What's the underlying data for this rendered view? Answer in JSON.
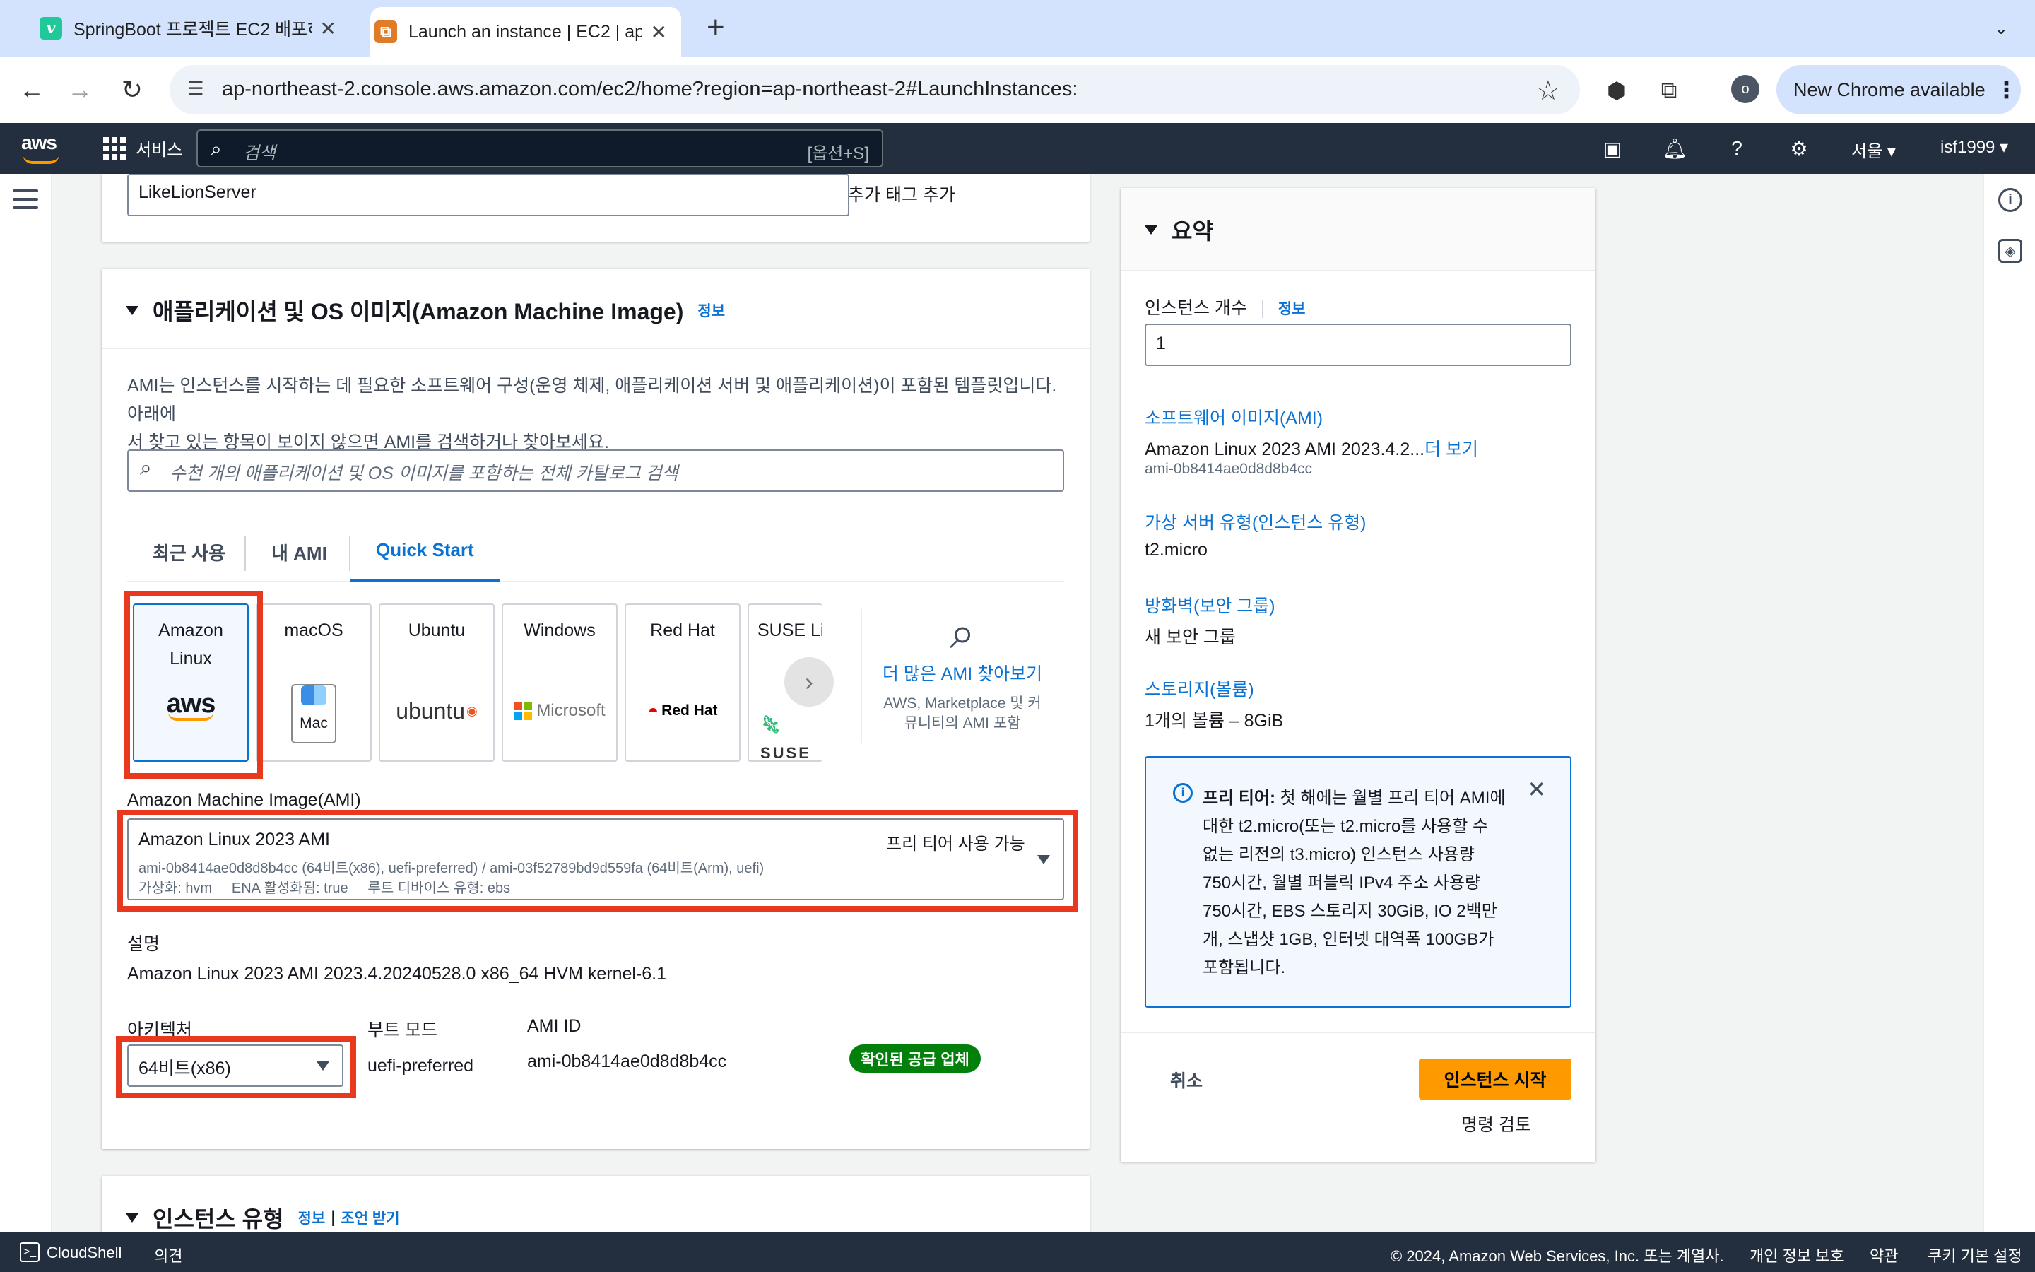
{
  "browser": {
    "tabs": [
      {
        "title": "SpringBoot 프로젝트 EC2 배포하기",
        "favicon": "v"
      },
      {
        "title": "Launch an instance | EC2 | ap-northeast-2",
        "favicon": "⧉"
      }
    ],
    "url": "ap-northeast-2.console.aws.amazon.com/ec2/home?region=ap-northeast-2#LaunchInstances:",
    "new_chrome_label": "New Chrome available",
    "profile_initial": "o"
  },
  "aws_nav": {
    "logo": "aws",
    "services_label": "서비스",
    "search_placeholder": "검색",
    "search_shortcut": "[옵션+S]",
    "region": "서울",
    "account": "isf1999"
  },
  "name_section": {
    "name_value": "LikeLionServer",
    "add_tag_label": "추가 태그 추가"
  },
  "ami_section": {
    "title": "애플리케이션 및 OS 이미지(Amazon Machine Image)",
    "info_label": "정보",
    "description": "AMI는 인스턴스를 시작하는 데 필요한 소프트웨어 구성(운영 체제, 애플리케이션 서버 및 애플리케이션)이 포함된 템플릿입니다. 아래에서 찾고 있는 항목이 보이지 않으면 AMI를 검색하거나 찾아보세요.",
    "description_line1": "AMI는 인스턴스를 시작하는 데 필요한 소프트웨어 구성(운영 체제, 애플리케이션 서버 및 애플리케이션)이 포함된 템플릿입니다. 아래에",
    "description_line2": "서 찾고 있는 항목이 보이지 않으면 AMI를 검색하거나 찾아보세요.",
    "search_placeholder": "수천 개의 애플리케이션 및 OS 이미지를 포함하는 전체 카탈로그 검색",
    "tabs": [
      {
        "label": "최근 사용",
        "active": false
      },
      {
        "label": "내 AMI",
        "active": false
      },
      {
        "label": "Quick Start",
        "active": true
      }
    ],
    "os_options": [
      {
        "label_line1": "Amazon",
        "label_line2": "Linux",
        "logo": "aws",
        "selected": true
      },
      {
        "label_line1": "macOS",
        "label_line2": "",
        "logo": "Mac",
        "selected": false
      },
      {
        "label_line1": "Ubuntu",
        "label_line2": "",
        "logo": "ubuntu",
        "selected": false
      },
      {
        "label_line1": "Windows",
        "label_line2": "",
        "logo": "Microsoft",
        "selected": false
      },
      {
        "label_line1": "Red Hat",
        "label_line2": "",
        "logo": "Red Hat",
        "selected": false
      },
      {
        "label_line1": "SUSE Lir",
        "label_line2": "",
        "logo": "SUSE",
        "selected": false
      }
    ],
    "browse_more_title": "더 많은 AMI 찾아보기",
    "browse_more_sub_line1": "AWS, Marketplace 및 커",
    "browse_more_sub_line2": "뮤니티의 AMI 포함",
    "ami_label": "Amazon Machine Image(AMI)",
    "ami_selected": {
      "name": "Amazon Linux 2023 AMI",
      "ids": "ami-0b8414ae0d8d8b4cc (64비트(x86), uefi-preferred) / ami-03f52789bd9d559fa (64비트(Arm), uefi)",
      "meta": "가상화: hvm     ENA 활성화됨: true     루트 디바이스 유형: ebs",
      "free_tier": "프리 티어 사용 가능"
    },
    "desc_label": "설명",
    "desc_value": "Amazon Linux 2023 AMI 2023.4.20240528.0 x86_64 HVM kernel-6.1",
    "arch_label": "아키텍처",
    "arch_value": "64비트(x86)",
    "boot_label": "부트 모드",
    "boot_value": "uefi-preferred",
    "amiid_label": "AMI ID",
    "amiid_value": "ami-0b8414ae0d8d8b4cc",
    "verified_badge": "확인된 공급 업체"
  },
  "instance_type_section": {
    "title": "인스턴스 유형",
    "info_label": "정보",
    "separator": "|",
    "advice_label": "조언 받기"
  },
  "summary": {
    "title": "요약",
    "count_label": "인스턴스 개수",
    "count_info": "정보",
    "count_value": "1",
    "software_label": "소프트웨어 이미지(AMI)",
    "software_value": "Amazon Linux 2023 AMI 2023.4.2...",
    "software_more": "더 보기",
    "software_id": "ami-0b8414ae0d8d8b4cc",
    "type_label": "가상 서버 유형(인스턴스 유형)",
    "type_value": "t2.micro",
    "firewall_label": "방화벽(보안 그룹)",
    "firewall_value": "새 보안 그룹",
    "storage_label": "스토리지(볼륨)",
    "storage_value": "1개의 볼륨 – 8GiB",
    "free_tier_title": "프리 티어:",
    "free_tier_lines": [
      "첫 해에는 월별 프리 티어 AMI에",
      "대한 t2.micro(또는 t2.micro를 사용할 수",
      "없는 리전의 t3.micro) 인스턴스 사용량",
      "750시간, 월별 퍼블릭 IPv4 주소 사용량",
      "750시간, EBS 스토리지 30GiB, IO 2백만",
      "개, 스냅샷 1GB, 인터넷 대역폭 100GB가",
      "포함됩니다."
    ],
    "cancel_label": "취소",
    "launch_label": "인스턴스 시작",
    "review_label": "명령 검토"
  },
  "footer": {
    "cloudshell": "CloudShell",
    "feedback": "의견",
    "copyright": "© 2024, Amazon Web Services, Inc. 또는 계열사.",
    "privacy": "개인 정보 보호",
    "terms": "약관",
    "cookies": "쿠키 기본 설정"
  },
  "colors": {
    "aws_nav": "#232f3e",
    "link": "#0972d3",
    "primary_button": "#ff9900",
    "highlight_box": "#e8391f",
    "verified_badge": "#037f0c"
  }
}
